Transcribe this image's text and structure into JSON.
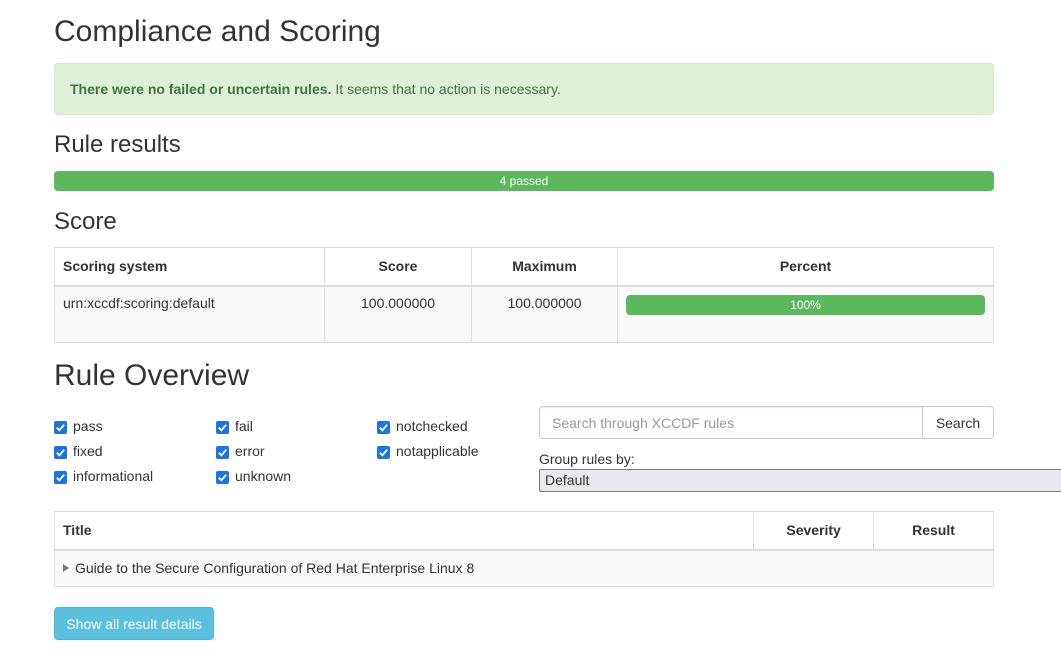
{
  "compliance": {
    "title": "Compliance and Scoring",
    "alert_bold": "There were no failed or uncertain rules.",
    "alert_text": "It seems that no action is necessary."
  },
  "rule_results": {
    "title": "Rule results",
    "passed_label": "4 passed",
    "passed_fraction": 1.0,
    "bar_color": "#5cb85c"
  },
  "score": {
    "title": "Score",
    "headers": [
      "Scoring system",
      "Score",
      "Maximum",
      "Percent"
    ],
    "rows": [
      {
        "system": "urn:xccdf:scoring:default",
        "score": "100.000000",
        "maximum": "100.000000",
        "percent_label": "100%",
        "percent_value": 100
      }
    ]
  },
  "overview": {
    "title": "Rule Overview",
    "filters": [
      {
        "label": "pass",
        "checked": true
      },
      {
        "label": "fixed",
        "checked": true
      },
      {
        "label": "informational",
        "checked": true
      },
      {
        "label": "fail",
        "checked": true
      },
      {
        "label": "error",
        "checked": true
      },
      {
        "label": "unknown",
        "checked": true
      },
      {
        "label": "notchecked",
        "checked": true
      },
      {
        "label": "notapplicable",
        "checked": true
      }
    ],
    "search": {
      "placeholder": "Search through XCCDF rules",
      "value": "",
      "button": "Search"
    },
    "group_by": {
      "label": "Group rules by:",
      "selected": "Default"
    }
  },
  "rules_table": {
    "headers": [
      "Title",
      "Severity",
      "Result"
    ],
    "rows": [
      {
        "title": "Guide to the Secure Configuration of Red Hat Enterprise Linux 8",
        "collapsed": true
      }
    ]
  },
  "actions": {
    "show_all": "Show all result details"
  },
  "colors": {
    "success": "#5cb85c",
    "alert_bg": "#dff0d8",
    "alert_text": "#3c763d",
    "info_button": "#5bc0de",
    "checkbox": "#1a73e8"
  }
}
